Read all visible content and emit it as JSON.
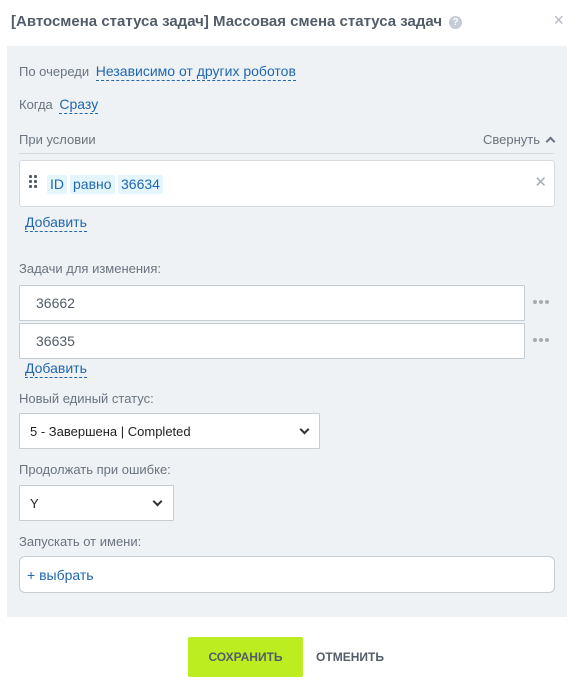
{
  "dialog": {
    "title": "[Автосмена статуса задач] Массовая смена статуса задач",
    "help_icon": "?"
  },
  "queue": {
    "label": "По очереди",
    "value": "Независимо от других роботов"
  },
  "when": {
    "label": "Когда",
    "value": "Сразу"
  },
  "condition": {
    "label": "При условии",
    "collapse_label": "Свернуть",
    "field": "ID",
    "operator": "равно",
    "value": "36634",
    "add_label": "Добавить"
  },
  "tasks": {
    "label": "Задачи для изменения:",
    "items": [
      "36662",
      "36635"
    ],
    "add_label": "Добавить"
  },
  "new_status": {
    "label": "Новый единый статус:",
    "selected": "5 - Завершена | Completed"
  },
  "continue_on_error": {
    "label": "Продолжать при ошибке:",
    "selected": "Y"
  },
  "run_as": {
    "label": "Запускать от имени:",
    "placeholder": "+ выбрать"
  },
  "footer": {
    "save_label": "СОХРАНИТЬ",
    "cancel_label": "ОТМЕНИТЬ"
  },
  "colors": {
    "accent": "#2067b0",
    "save_button": "#bbed21",
    "panel_bg": "#eef2f4",
    "chip_bg": "#e5f5fc"
  }
}
